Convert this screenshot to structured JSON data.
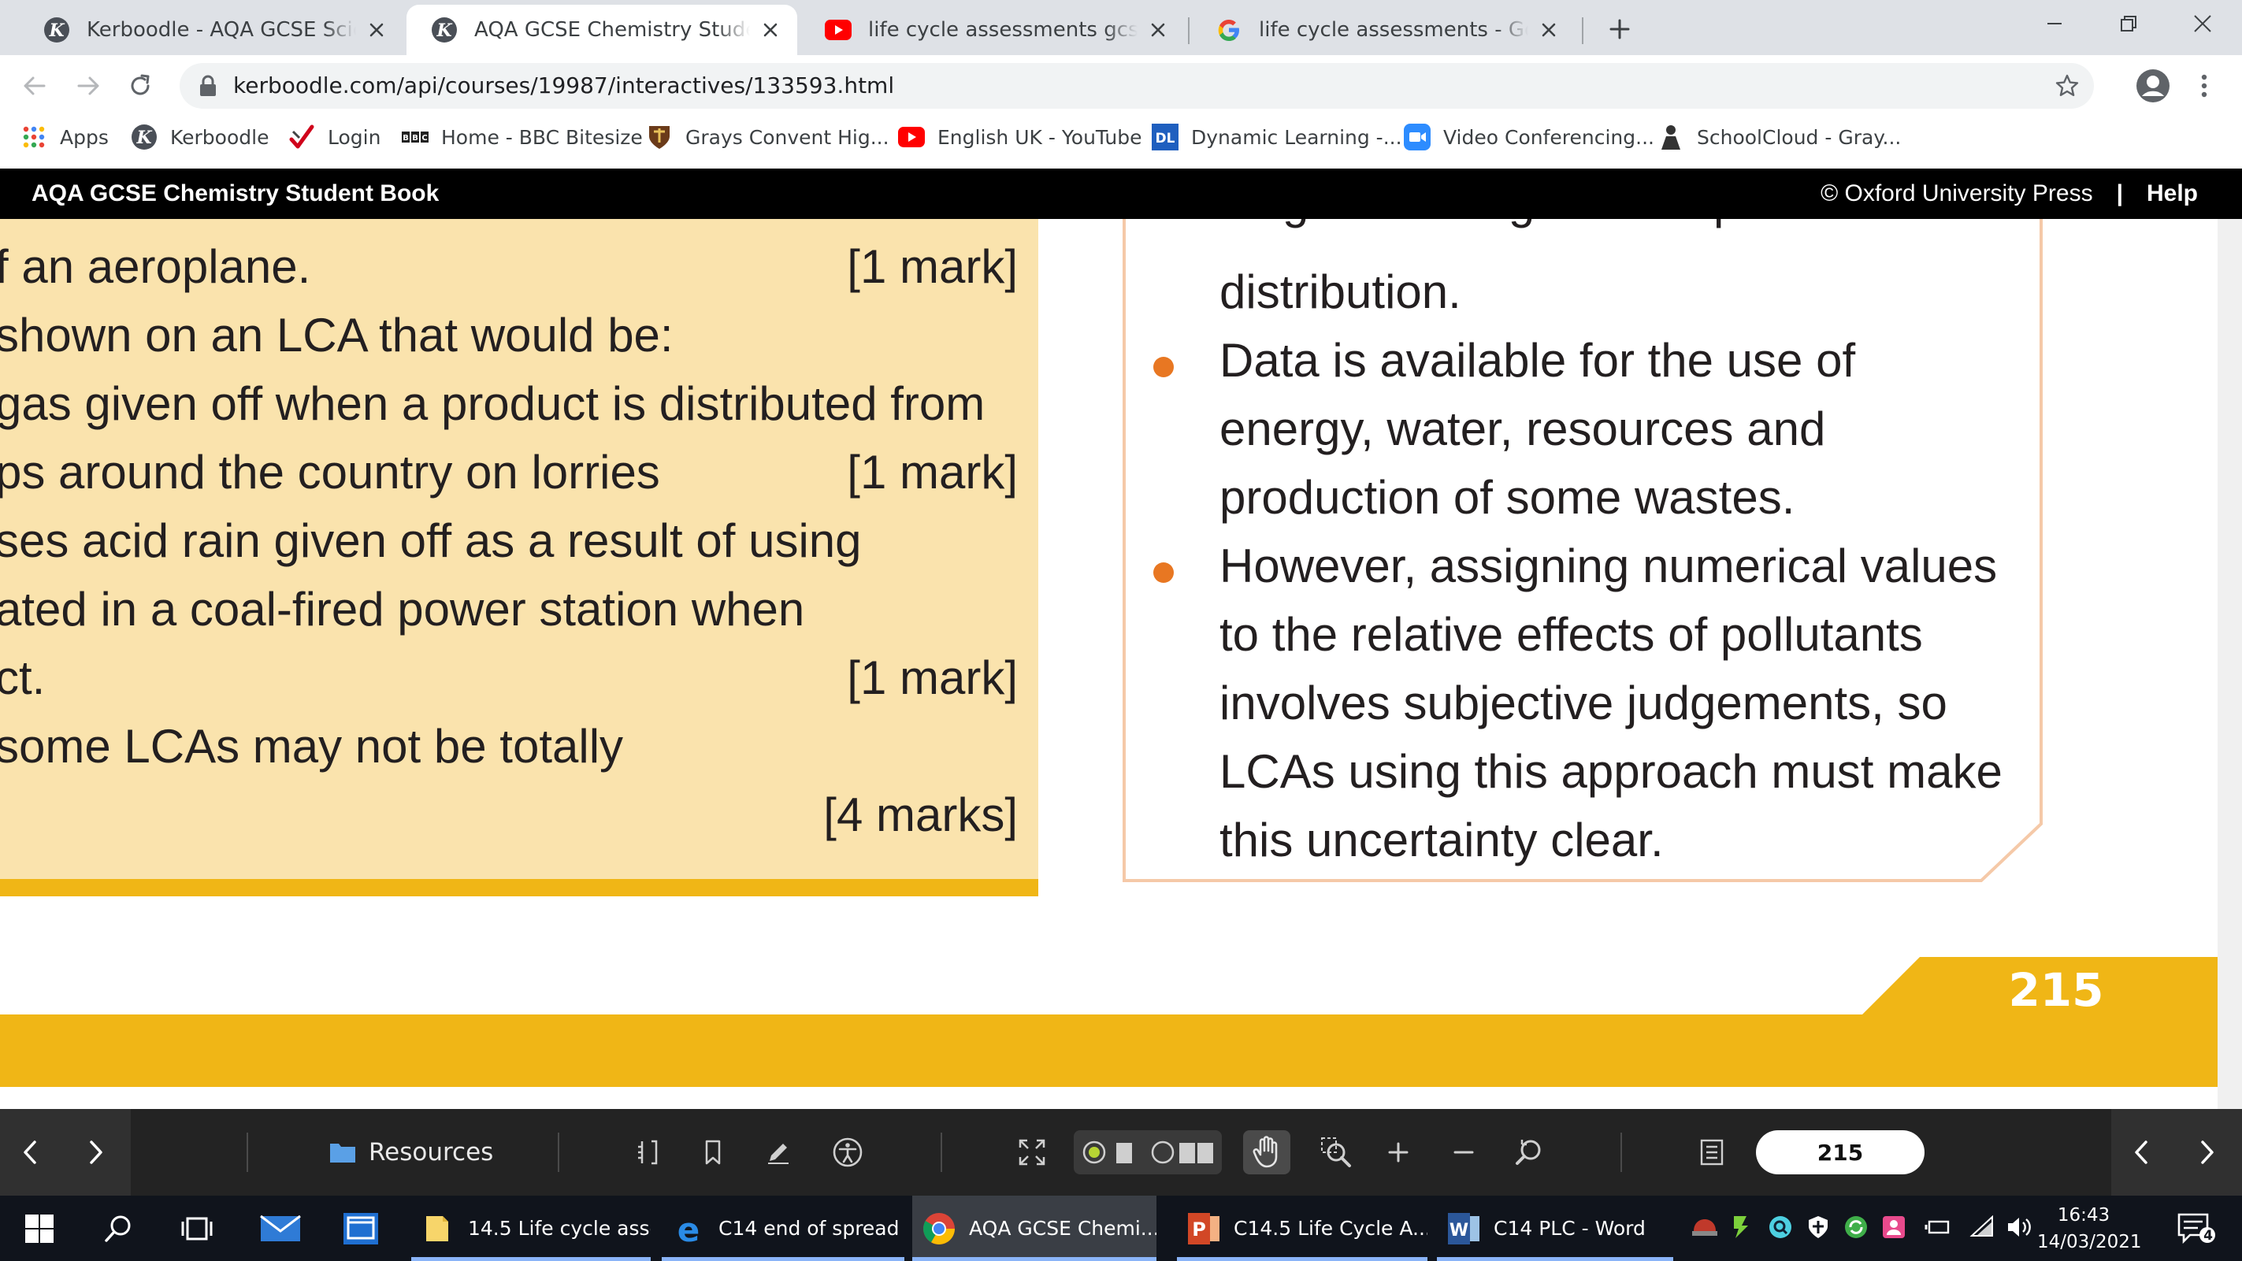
{
  "browser": {
    "tabs": [
      {
        "title": "Kerboodle - AQA GCSE Sciences",
        "icon": "kerboodle-icon",
        "active": false
      },
      {
        "title": "AQA GCSE Chemistry Student Book",
        "icon": "kerboodle-icon",
        "active": true
      },
      {
        "title": "life cycle assessments gcse chemistry",
        "icon": "youtube-icon",
        "active": false
      },
      {
        "title": "life cycle assessments - Google Search",
        "icon": "google-icon",
        "active": false
      }
    ],
    "url": "kerboodle.com/api/courses/19987/interactives/133593.html",
    "bookmarks": [
      {
        "label": "Apps",
        "icon": "apps-grid-icon"
      },
      {
        "label": "Kerboodle",
        "icon": "kerboodle-icon"
      },
      {
        "label": "Login",
        "icon": "login-icon"
      },
      {
        "label": "Home - BBC Bitesize",
        "icon": "bbc-icon"
      },
      {
        "label": "Grays Convent Hig...",
        "icon": "school-crest-icon"
      },
      {
        "label": "English UK - YouTube",
        "icon": "youtube-icon"
      },
      {
        "label": "Dynamic Learning -...",
        "icon": "dynamic-learning-icon"
      },
      {
        "label": "Video Conferencing...",
        "icon": "video-conferencing-icon"
      },
      {
        "label": "SchoolCloud - Gray...",
        "icon": "schoolcloud-icon"
      }
    ]
  },
  "reader": {
    "title": "AQA GCSE Chemistry Student Book",
    "copyright": "© Oxford University Press",
    "separator": "|",
    "help": "Help",
    "questions": [
      "f an aeroplane.",
      "shown on an LCA that would be:",
      "gas given off when a product is distributed from",
      "ps around the country on lorries",
      "ses acid rain given off as a result of using",
      "ated in a coal-fired power station when",
      "ct.",
      "some LCAs may not be totally"
    ],
    "marks": [
      "[1 mark]",
      "[1 mark]",
      "[1 mark]",
      "[4 marks]"
    ],
    "info_lines": [
      "stage including all transport and",
      "distribution.",
      "Data is available for the use of",
      "energy, water, resources and",
      "production of some wastes.",
      "However, assigning numerical values",
      "to the relative effects of pollutants",
      "involves subjective judgements, so",
      "LCAs using this approach must make",
      "this uncertainty clear."
    ],
    "page_number": "215",
    "controls": {
      "resources_label": "Resources",
      "page_input": "215"
    }
  },
  "colors": {
    "question_box": "#fae3ad",
    "accent_yellow": "#f0b616",
    "bullet_orange": "#e87722",
    "info_border": "#f5c9a8"
  },
  "taskbar": {
    "apps": [
      {
        "label": "14.5 Life cycle asse...",
        "icon": "file-explorer-icon"
      },
      {
        "label": "C14 end of spread ...",
        "icon": "edge-icon"
      },
      {
        "label": "AQA GCSE Chemi...",
        "icon": "chrome-icon",
        "active": true
      },
      {
        "label": "C14.5 Life Cycle A...",
        "icon": "powerpoint-icon"
      },
      {
        "label": "C14 PLC - Word",
        "icon": "word-icon"
      }
    ],
    "time": "16:43",
    "date": "14/03/2021",
    "notification_count": "4"
  }
}
